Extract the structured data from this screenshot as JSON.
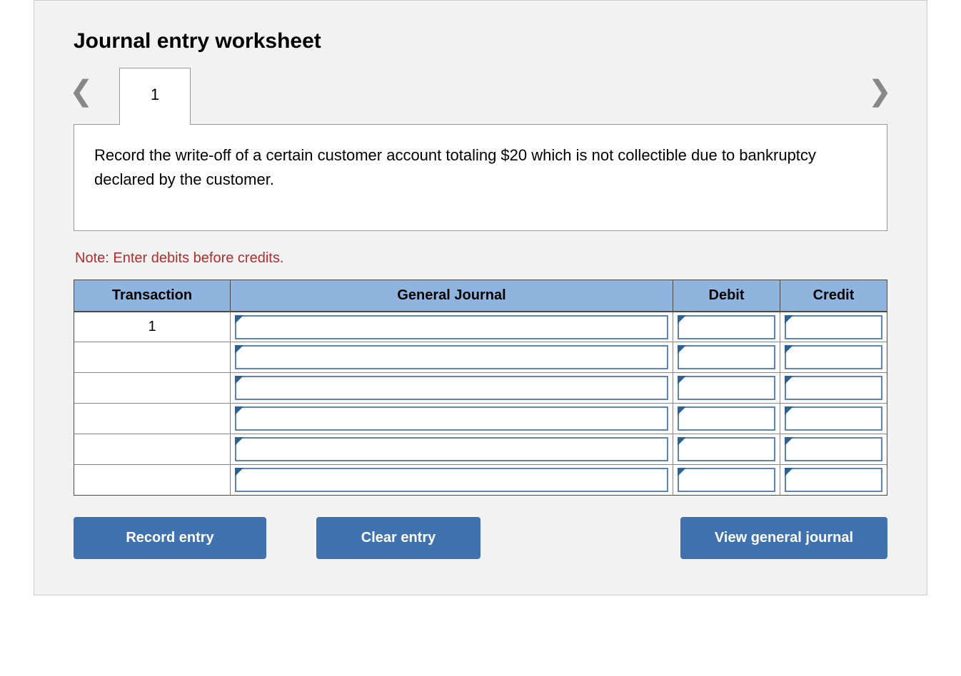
{
  "title": "Journal entry worksheet",
  "tab_label": "1",
  "instruction": "Record the write-off of a certain customer account totaling $20 which is not collectible due to bankruptcy declared by the customer.",
  "note": "Note: Enter debits before credits.",
  "headers": {
    "transaction": "Transaction",
    "general_journal": "General Journal",
    "debit": "Debit",
    "credit": "Credit"
  },
  "rows": [
    {
      "transaction": "1",
      "general_journal": "",
      "debit": "",
      "credit": ""
    },
    {
      "transaction": "",
      "general_journal": "",
      "debit": "",
      "credit": ""
    },
    {
      "transaction": "",
      "general_journal": "",
      "debit": "",
      "credit": ""
    },
    {
      "transaction": "",
      "general_journal": "",
      "debit": "",
      "credit": ""
    },
    {
      "transaction": "",
      "general_journal": "",
      "debit": "",
      "credit": ""
    },
    {
      "transaction": "",
      "general_journal": "",
      "debit": "",
      "credit": ""
    }
  ],
  "buttons": {
    "record": "Record entry",
    "clear": "Clear entry",
    "view": "View general journal"
  }
}
